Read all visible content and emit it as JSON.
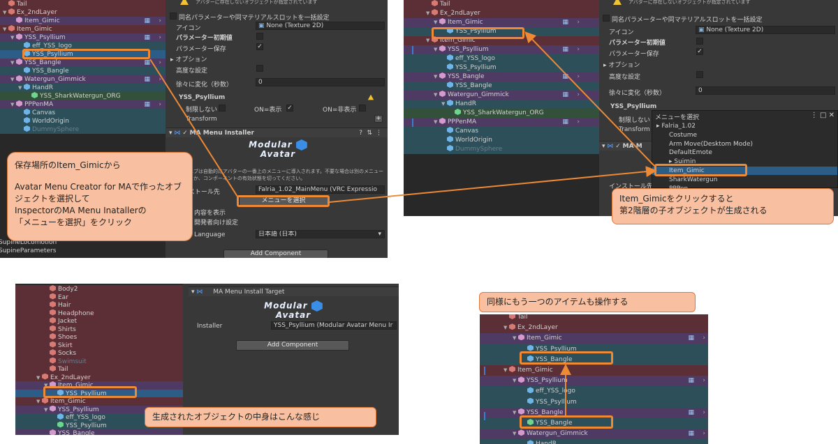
{
  "panel1": {
    "hier_rows": [
      {
        "label": "Tail",
        "indent": 0,
        "icon": "cube-red",
        "tint": "tint-red"
      },
      {
        "label": "Ex_2ndLayer",
        "indent": 0,
        "icon": "cube-red",
        "tint": "tint-red",
        "arrow": "down"
      },
      {
        "label": "Item_Gimic",
        "indent": 1,
        "icon": "cube-pink",
        "tint": "tint-purple"
      },
      {
        "label": "Item_Gimic",
        "indent": 0,
        "icon": "cube-red",
        "tint": "tint-red",
        "arrow": "down"
      },
      {
        "label": "YSS_Psyllium",
        "indent": 1,
        "icon": "cube-pink",
        "tint": "tint-purple",
        "arrow": "down"
      },
      {
        "label": "eff_YSS_logo",
        "indent": 2,
        "icon": "cube-blue",
        "tint": "tint-teal"
      },
      {
        "label": "YSS_Psyllium",
        "indent": 2,
        "icon": "cube-blue",
        "tint": "",
        "hl": true
      },
      {
        "label": "YSS_Bangle",
        "indent": 1,
        "icon": "cube-pink",
        "tint": "tint-purple",
        "arrow": "down"
      },
      {
        "label": "YSS_Bangle",
        "indent": 2,
        "icon": "cube-blue",
        "tint": "tint-teal"
      },
      {
        "label": "Watergun_Gimmick",
        "indent": 1,
        "icon": "cube-pink",
        "tint": "tint-purple",
        "arrow": "down"
      },
      {
        "label": "HandR",
        "indent": 2,
        "icon": "cube-blue",
        "tint": "tint-teal",
        "arrow": "down"
      },
      {
        "label": "YSS_SharkWatergun_ORG",
        "indent": 3,
        "icon": "cube-green",
        "tint": "tint-green"
      },
      {
        "label": "PPPenMA",
        "indent": 1,
        "icon": "cube-pink",
        "tint": "tint-purple",
        "arrow": "down"
      },
      {
        "label": "Canvas",
        "indent": 2,
        "icon": "cube-blue",
        "tint": "tint-teal"
      },
      {
        "label": "WorldOrigin",
        "indent": 2,
        "icon": "cube-blue",
        "tint": "tint-teal"
      },
      {
        "label": "DummySphere",
        "indent": 2,
        "icon": "cube-blue",
        "tint": "tint-teal",
        "dim": true
      }
    ],
    "bottom_rows": [
      "SupineLocomotion",
      "SupineParameters"
    ],
    "insp": {
      "warn_text": "アバターに存在しないオブジェクトが指定されています",
      "bulk_label": "同名パラメーターや同マテリアルスロットを一括設定",
      "icon_label": "アイコン",
      "icon_value": "None (Texture 2D)",
      "param_init": "パラメーター初期値",
      "param_save": "パラメーター保存",
      "options": "オプション",
      "advanced": "高度な設定",
      "gradual": "徐々に変化（秒数）",
      "gradual_value": "0",
      "obj_name": "YSS_Psyllium",
      "unlimited": "制限しない",
      "on_show": "ON=表示",
      "on_hide": "ON=非表示",
      "transform": "Transform",
      "installer_title": "MA Menu Installer",
      "logo_line1": "Modular",
      "logo_line2": "Avatar",
      "desc": "このプレハブは自動的にアバターの一番上のメニューに導入されます。不要な場合は別のメニューを指定するか、コンポーネントの有効状態を切ってください。",
      "install_to": "インストール先",
      "install_value": "Falria_1.02_MainMenu (VRC Expressio",
      "select_menu": "メニューを選択",
      "show_content": "内容を表示",
      "dev_settings": "開発者向け設定",
      "language": "Language",
      "language_value": "日本語 (日本)",
      "add_component": "Add Component"
    }
  },
  "panel2": {
    "hier_rows": [
      {
        "label": "Tail",
        "indent": 0,
        "icon": "cube-red",
        "tint": "tint-red"
      },
      {
        "label": "Ex_2ndLayer",
        "indent": 0,
        "icon": "cube-red",
        "tint": "tint-red",
        "arrow": "down"
      },
      {
        "label": "Item_Gimic",
        "indent": 1,
        "icon": "cube-pink",
        "tint": "tint-purple",
        "arrow": "down"
      },
      {
        "label": "YSS_Psyllium",
        "indent": 2,
        "icon": "cube-blue",
        "tint": "tint-teal"
      },
      {
        "label": "Item_Gimic",
        "indent": 0,
        "icon": "cube-red",
        "tint": "tint-red",
        "arrow": "down"
      },
      {
        "label": "YSS_Psyllium",
        "indent": 1,
        "icon": "cube-pink",
        "tint": "tint-purple",
        "arrow": "down"
      },
      {
        "label": "eff_YSS_logo",
        "indent": 2,
        "icon": "cube-blue",
        "tint": "tint-teal"
      },
      {
        "label": "YSS_Psyllium",
        "indent": 2,
        "icon": "cube-blue",
        "tint": "tint-teal"
      },
      {
        "label": "YSS_Bangle",
        "indent": 1,
        "icon": "cube-pink",
        "tint": "tint-purple",
        "arrow": "down"
      },
      {
        "label": "YSS_Bangle",
        "indent": 2,
        "icon": "cube-blue",
        "tint": "tint-teal"
      },
      {
        "label": "Watergun_Gimmick",
        "indent": 1,
        "icon": "cube-pink",
        "tint": "tint-purple",
        "arrow": "down"
      },
      {
        "label": "HandR",
        "indent": 2,
        "icon": "cube-blue",
        "tint": "tint-teal",
        "arrow": "down"
      },
      {
        "label": "YSS_SharkWatergun_ORG",
        "indent": 3,
        "icon": "cube-green",
        "tint": "tint-green"
      },
      {
        "label": "PPPenMA",
        "indent": 1,
        "icon": "cube-pink",
        "tint": "tint-purple",
        "arrow": "down"
      },
      {
        "label": "Canvas",
        "indent": 2,
        "icon": "cube-blue",
        "tint": "tint-teal"
      },
      {
        "label": "WorldOrigin",
        "indent": 2,
        "icon": "cube-blue",
        "tint": "tint-teal"
      },
      {
        "label": "DummySphere",
        "indent": 2,
        "icon": "cube-blue",
        "tint": "tint-teal",
        "dim": true
      }
    ],
    "insp": {
      "warn_text": "アバターに存在しないオブジェクトが指定されています",
      "bulk_label": "同名パラメーターや同マテリアルスロットを一括設定",
      "icon_label": "アイコン",
      "icon_value": "None (Texture 2D)",
      "param_init": "パラメーター初期値",
      "param_save": "パラメーター保存",
      "options": "オプション",
      "advanced": "高度な設定",
      "gradual": "徐々に変化（秒数）",
      "gradual_value": "0",
      "obj_name": "YSS_Psyllium",
      "unlimited": "制限しない",
      "transform": "Transform",
      "installer_short": "MA M",
      "install_to": "インストール先"
    },
    "popup": {
      "title": "メニューを選択",
      "items": [
        "Falria_1.02",
        "Costume",
        "Arm Move(Desktom Mode)",
        "DefaultEmote",
        "Suimin",
        "Item_Gimic",
        "SharkWatergun",
        "PPPen"
      ]
    }
  },
  "panel3": {
    "hier_rows": [
      {
        "label": "Body2",
        "indent": 1,
        "icon": "cube-red",
        "tint": "tint-red"
      },
      {
        "label": "Ear",
        "indent": 1,
        "icon": "cube-red",
        "tint": "tint-red"
      },
      {
        "label": "Hair",
        "indent": 1,
        "icon": "cube-red",
        "tint": "tint-red"
      },
      {
        "label": "Headphone",
        "indent": 1,
        "icon": "cube-red",
        "tint": "tint-red"
      },
      {
        "label": "Jacket",
        "indent": 1,
        "icon": "cube-red",
        "tint": "tint-red"
      },
      {
        "label": "Shirts",
        "indent": 1,
        "icon": "cube-red",
        "tint": "tint-red"
      },
      {
        "label": "Shoes",
        "indent": 1,
        "icon": "cube-red",
        "tint": "tint-red"
      },
      {
        "label": "Skirt",
        "indent": 1,
        "icon": "cube-red",
        "tint": "tint-red"
      },
      {
        "label": "Socks",
        "indent": 1,
        "icon": "cube-red",
        "tint": "tint-red"
      },
      {
        "label": "Swimsuit",
        "indent": 1,
        "icon": "cube-red",
        "tint": "tint-red",
        "dim": true
      },
      {
        "label": "Tail",
        "indent": 1,
        "icon": "cube-red",
        "tint": "tint-red"
      },
      {
        "label": "Ex_2ndLayer",
        "indent": 0,
        "icon": "cube-red",
        "tint": "tint-red",
        "arrow": "down"
      },
      {
        "label": "Item_Gimic",
        "indent": 1,
        "icon": "cube-pink",
        "tint": "tint-purple",
        "arrow": "down"
      },
      {
        "label": "YSS_Psyllium",
        "indent": 2,
        "icon": "cube-blue",
        "tint": "",
        "hl": true
      },
      {
        "label": "Item_Gimic",
        "indent": 0,
        "icon": "cube-red",
        "tint": "tint-red",
        "arrow": "down"
      },
      {
        "label": "YSS_Psyllium",
        "indent": 1,
        "icon": "cube-pink",
        "tint": "tint-purple",
        "arrow": "down"
      },
      {
        "label": "eff_YSS_logo",
        "indent": 2,
        "icon": "cube-blue",
        "tint": "tint-teal"
      },
      {
        "label": "YSS_Psyllium",
        "indent": 2,
        "icon": "cube-green",
        "tint": "tint-teal"
      },
      {
        "label": "YSS_Bangle",
        "indent": 1,
        "icon": "cube-pink",
        "tint": "tint-purple"
      }
    ],
    "insp": {
      "title": "MA Menu Install Target",
      "logo_line1": "Modular",
      "logo_line2": "Avatar",
      "installer_label": "Installer",
      "installer_value": "YSS_Psyllium (Modular Avatar Menu Ir",
      "add_component": "Add Component"
    }
  },
  "panel4": {
    "hier_rows": [
      {
        "label": "Tail",
        "indent": 0,
        "icon": "cube-red",
        "tint": "tint-red"
      },
      {
        "label": "Ex_2ndLayer",
        "indent": 0,
        "icon": "cube-red",
        "tint": "tint-red",
        "arrow": "down"
      },
      {
        "label": "Item_Gimic",
        "indent": 1,
        "icon": "cube-pink",
        "tint": "tint-purple",
        "arrow": "down"
      },
      {
        "label": "YSS_Psyllium",
        "indent": 2,
        "icon": "cube-blue",
        "tint": "tint-teal"
      },
      {
        "label": "YSS_Bangle",
        "indent": 2,
        "icon": "cube-blue",
        "tint": "tint-teal"
      },
      {
        "label": "Item_Gimic",
        "indent": 0,
        "icon": "cube-red",
        "tint": "tint-red",
        "arrow": "down"
      },
      {
        "label": "YSS_Psyllium",
        "indent": 1,
        "icon": "cube-pink",
        "tint": "tint-purple",
        "arrow": "down"
      },
      {
        "label": "eff_YSS_logo",
        "indent": 2,
        "icon": "cube-blue",
        "tint": "tint-teal"
      },
      {
        "label": "YSS_Psyllium",
        "indent": 2,
        "icon": "cube-blue",
        "tint": "tint-teal"
      },
      {
        "label": "YSS_Bangle",
        "indent": 1,
        "icon": "cube-pink",
        "tint": "tint-purple",
        "arrow": "down"
      },
      {
        "label": "YSS_Bangle",
        "indent": 2,
        "icon": "cube-green",
        "tint": "tint-teal"
      },
      {
        "label": "Watergun_Gimmick",
        "indent": 1,
        "icon": "cube-pink",
        "tint": "tint-purple",
        "arrow": "down"
      },
      {
        "label": "HandR",
        "indent": 2,
        "icon": "cube-blue",
        "tint": "tint-teal"
      }
    ]
  },
  "callouts": {
    "c1_line1": "保存場所のItem_Gimicから",
    "c1_line2": "Avatar Menu Creator for MAで作ったオブジェクトを選択して",
    "c1_line3": "InspectorのMA Menu Inatallerの",
    "c1_line4": "「メニューを選択」をクリック",
    "c2_line1": "Item_Gimicをクリックすると",
    "c2_line2": "第2階層の子オブジェクトが生成される",
    "c3": "生成されたオブジェクトの中身はこんな感じ",
    "c4": "同様にもう一つのアイテムも操作する"
  },
  "colors": {
    "accent": "#ee8a35",
    "callout_bg": "#f8c0a0",
    "selection": "#2c5d87"
  }
}
